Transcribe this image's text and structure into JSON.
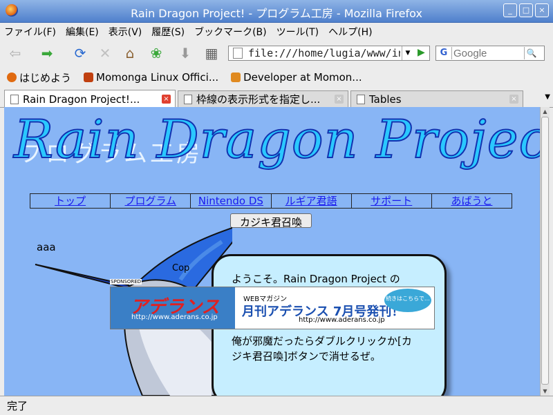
{
  "window": {
    "title": "Rain Dragon Project! - プログラム工房 - Mozilla Firefox",
    "buttons": [
      "_",
      "□",
      "×"
    ]
  },
  "menu": [
    "ファイル(F)",
    "編集(E)",
    "表示(V)",
    "履歴(S)",
    "ブックマーク(B)",
    "ツール(T)",
    "ヘルプ(H)"
  ],
  "nav": {
    "back": "⇦",
    "forward": "➡",
    "reload": "⟳",
    "stop": "✕",
    "home": "⌂",
    "url": "file:///home/lugia/www/inc",
    "search_placeholder": "Google",
    "search_engine": "G"
  },
  "bookmarks": [
    {
      "label": "はじめよう",
      "color": "#e06a10"
    },
    {
      "label": "Momonga Linux Offici...",
      "color": "#c04010"
    },
    {
      "label": "Developer at Momon...",
      "color": "#e08a20"
    }
  ],
  "tabs": [
    {
      "label": "Rain Dragon Project!..."
    },
    {
      "label": "枠線の表示形式を指定し..."
    },
    {
      "label": "Tables"
    }
  ],
  "page": {
    "logo": "Rain Dragon Project",
    "logo_ghost": "プログラム工房",
    "nav_links": [
      "トップ",
      "プログラム",
      "Nintendo DS",
      "ルギア君語",
      "サポート",
      "あばうと"
    ],
    "summon_button": "カジキ君召喚",
    "aaa": "aaa",
    "copyright": "Cop",
    "bubble_lines": [
      "ようこそ。Rain Dragon Project の",
      "俺が邪魔だったらダブルクリックか[カ",
      "ジキ君召喚]ボタンで消せるぜ。"
    ],
    "ad": {
      "sponsored": "SPONSORED",
      "brand": "アデランス",
      "brand_url": "http://www.aderans.co.jp",
      "small": "WEBマガジン",
      "headline": "月刊アデランス 7月号発刊！",
      "url2": "http://www.aderans.co.jp",
      "circle": "続きはこちらで…"
    }
  },
  "status": "完了"
}
